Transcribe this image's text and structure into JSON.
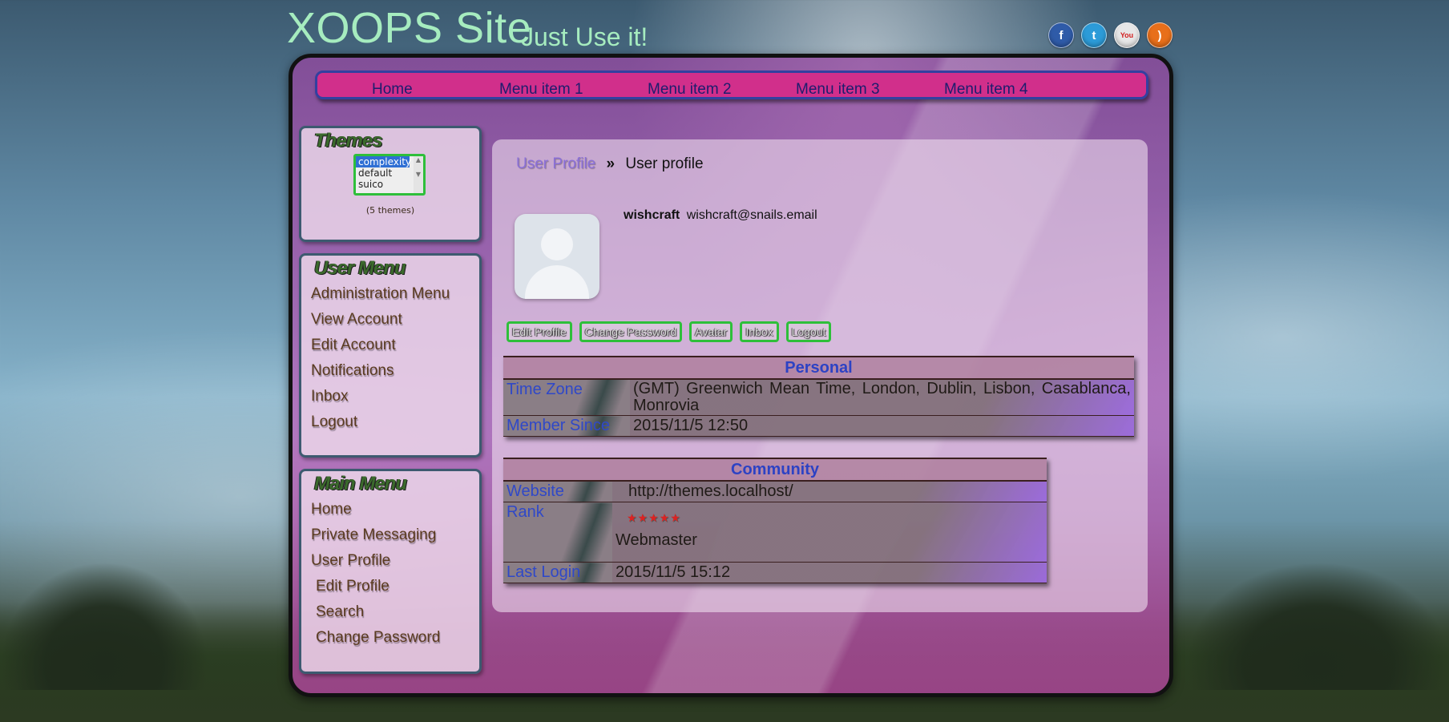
{
  "site": {
    "title": "XOOPS Site",
    "slogan": "Just Use it!"
  },
  "social": [
    "facebook-icon",
    "twitter-icon",
    "youtube-icon",
    "rss-icon"
  ],
  "nav": {
    "items": [
      "Home",
      "Menu item 1",
      "Menu item 2",
      "Menu item 3",
      "Menu item 4"
    ]
  },
  "themes_block": {
    "title": "Themes",
    "options": [
      "complexity",
      "default",
      "suico"
    ],
    "selected": "complexity",
    "count": "(5 themes)"
  },
  "user_menu": {
    "title": "User Menu",
    "items": [
      "Administration Menu",
      "View Account",
      "Edit Account",
      "Notifications",
      "Inbox",
      "Logout"
    ]
  },
  "main_menu": {
    "title": "Main Menu",
    "items": [
      "Home",
      "Private Messaging",
      "User Profile",
      "Edit Profile",
      "Search",
      "Change Password"
    ]
  },
  "content": {
    "breadcrumb": {
      "link": "User Profile",
      "sep": "»",
      "current": "User profile"
    },
    "user": {
      "name": "wishcraft",
      "email": "wishcraft@snails.email"
    },
    "buttons": [
      "Edit Profile",
      "Change Password",
      "Avatar",
      "Inbox",
      "Logout"
    ],
    "personal": {
      "heading": "Personal",
      "rows": [
        {
          "label": "Time Zone",
          "value": "(GMT) Greenwich Mean Time, London, Dublin, Lisbon, Casablanca, Monrovia"
        },
        {
          "label": "Member Since",
          "value": "2015/11/5 12:50"
        }
      ]
    },
    "community": {
      "heading": "Community",
      "website_label": "Website",
      "website_value": "http://themes.localhost/",
      "rank_label": "Rank",
      "rank_stars": "★★★★★",
      "rank_value": "Webmaster",
      "last_login_label": "Last Login",
      "last_login_value": "2015/11/5 15:12"
    }
  },
  "colors": {
    "nav_bg": "#d12f8b",
    "title_green": "#a6ecbf",
    "label_blue": "#2f48c8",
    "button_border": "#2ebf3a"
  }
}
